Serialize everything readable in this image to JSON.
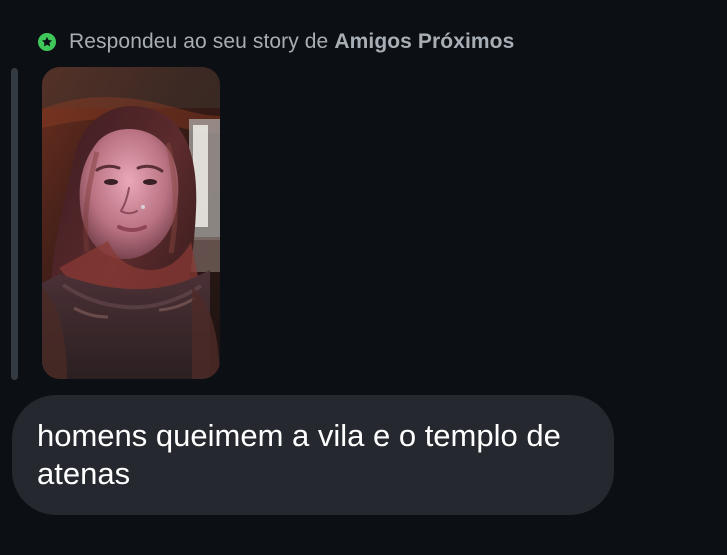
{
  "reply_context": {
    "prefix": "Respondeu ao seu story de",
    "audience": "Amigos Próximos",
    "badge_icon": "star-icon",
    "badge_color": "#40c75a"
  },
  "story": {
    "image_subject": "selfie-photo",
    "corner_radius_style": "rounded"
  },
  "message": {
    "text": "homens queimem a vila e o templo de atenas"
  },
  "colors": {
    "background": "#0c1014",
    "bubble": "#25292f",
    "muted_text": "#a8aeb5",
    "message_text": "#ffffff"
  }
}
